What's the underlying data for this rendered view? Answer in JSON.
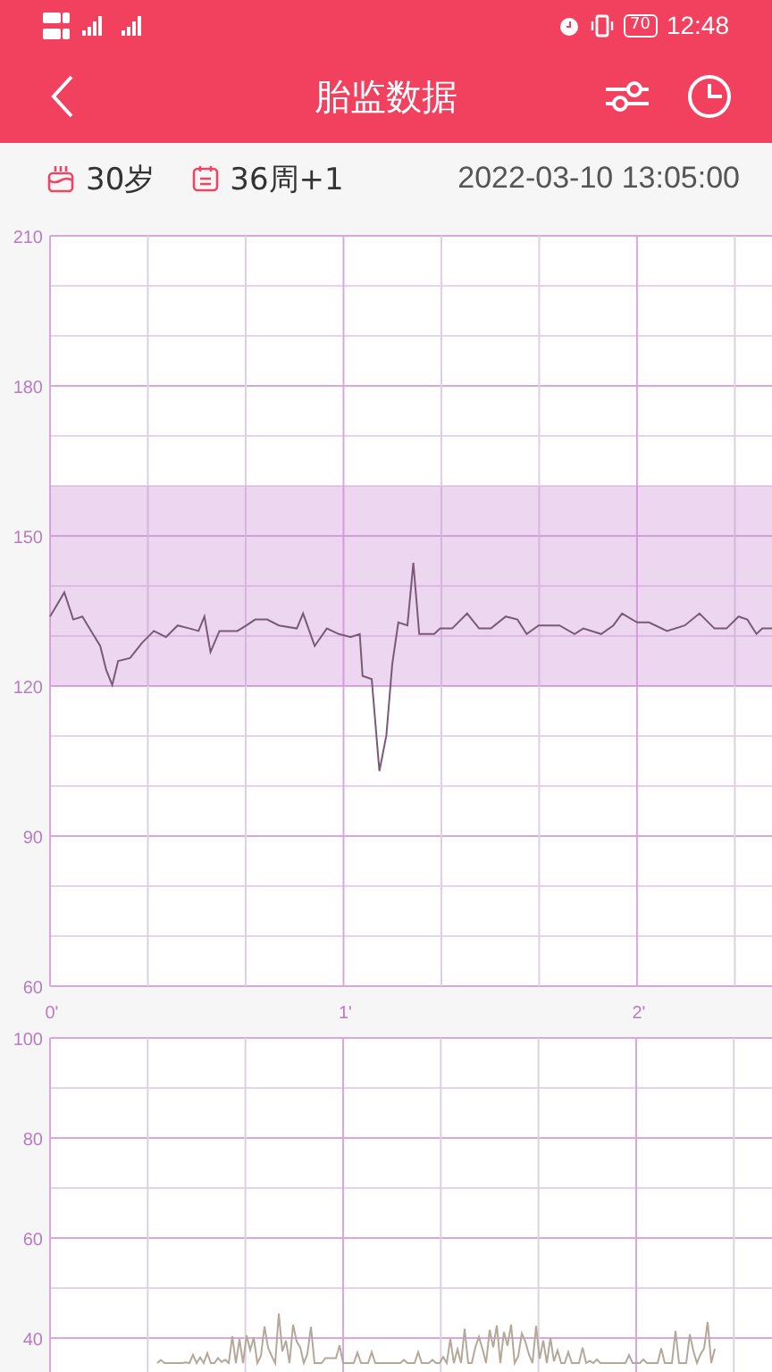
{
  "status_bar": {
    "battery": "70",
    "time": "12:48"
  },
  "header": {
    "title": "胎监数据"
  },
  "info": {
    "age": "30岁",
    "gestation": "36周+1",
    "datetime": "2022-03-10 13:05:00"
  },
  "heart_chart": {
    "chart_data": {
      "type": "line",
      "grid": true,
      "xlim": [
        0,
        2.46
      ],
      "ylim": [
        60,
        210
      ],
      "yticks": [
        210,
        180,
        150,
        120,
        90,
        60
      ],
      "xticks": [
        {
          "value": 0,
          "label": "0'"
        },
        {
          "value": 1,
          "label": "1'"
        },
        {
          "value": 2,
          "label": "2'"
        }
      ],
      "bands": [
        {
          "axis": "y",
          "from": 120,
          "to": 160,
          "color": "#c98ad3"
        }
      ],
      "x": [
        0,
        0.049,
        0.079,
        0.11,
        0.14,
        0.171,
        0.191,
        0.212,
        0.232,
        0.273,
        0.313,
        0.354,
        0.395,
        0.435,
        0.476,
        0.506,
        0.526,
        0.547,
        0.577,
        0.638,
        0.669,
        0.699,
        0.74,
        0.78,
        0.841,
        0.862,
        0.902,
        0.943,
        0.984,
        1.024,
        1.055,
        1.065,
        1.096,
        1.122,
        1.146,
        1.166,
        1.187,
        1.218,
        1.238,
        1.258,
        1.309,
        1.329,
        1.37,
        1.421,
        1.462,
        1.502,
        1.553,
        1.593,
        1.624,
        1.665,
        1.736,
        1.787,
        1.817,
        1.878,
        1.919,
        1.949,
        2.0,
        2.041,
        2.102,
        2.163,
        2.213,
        2.264,
        2.305,
        2.346,
        2.376,
        2.407,
        2.427,
        2.46
      ],
      "series": [
        {
          "color": "#7a5a78",
          "values": [
            133.9,
            138.7,
            133.3,
            133.9,
            131,
            128,
            123.2,
            120.2,
            125,
            125.6,
            128.6,
            131,
            129.8,
            132.1,
            131.5,
            131,
            133.9,
            126.8,
            131,
            131,
            132.1,
            133.3,
            133.3,
            132.1,
            131.5,
            134.5,
            128,
            131.5,
            130.4,
            129.8,
            130.4,
            122,
            121.4,
            103,
            110.1,
            124.4,
            132.7,
            132.1,
            144.6,
            130.4,
            130.4,
            131.5,
            131.5,
            134.5,
            131.5,
            131.5,
            133.9,
            133.3,
            130.4,
            132.1,
            132.1,
            130.4,
            131.5,
            130.4,
            132.1,
            134.5,
            132.7,
            132.7,
            131,
            132.1,
            134.5,
            131.5,
            131.5,
            133.9,
            133.3,
            130.4,
            131.5,
            131.5
          ]
        }
      ]
    }
  },
  "contraction_chart": {
    "y_ticks": [
      "100",
      "80",
      "60",
      "40"
    ]
  }
}
